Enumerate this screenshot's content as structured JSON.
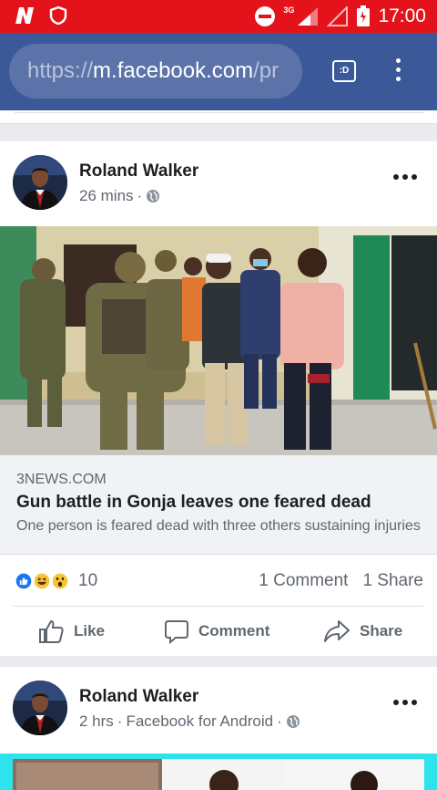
{
  "status_bar": {
    "time": "17:00",
    "network": "3G",
    "app_icons": [
      "n-app-icon",
      "shield-icon"
    ],
    "bar_color": "#e4121a"
  },
  "browser": {
    "url_scheme": "https://",
    "url_host": "m.facebook.com",
    "url_path": "/pr",
    "tab_label": ":D",
    "theme_color": "#3b5998"
  },
  "posts": [
    {
      "author": "Roland Walker",
      "time": "26 mins",
      "separator": "·",
      "link": {
        "domain": "3NEWS.COM",
        "title": "Gun battle in Gonja leaves one feared dead",
        "description": "One person is feared dead with three others sustaining injuries"
      },
      "reaction_count": "10",
      "comments": "1 Comment",
      "shares": "1 Share",
      "actions": {
        "like": "Like",
        "comment": "Comment",
        "share": "Share"
      }
    },
    {
      "author": "Roland Walker",
      "time": "2 hrs",
      "separator": "·",
      "via": "Facebook for Android",
      "separator2": "·"
    }
  ]
}
